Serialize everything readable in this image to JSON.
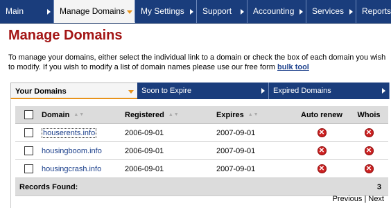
{
  "topnav": {
    "tabs": [
      {
        "label": "Main"
      },
      {
        "label": "Manage Domains",
        "active": true
      },
      {
        "label": "My Settings"
      },
      {
        "label": "Support"
      },
      {
        "label": "Accounting"
      },
      {
        "label": "Services"
      },
      {
        "label": "Reports"
      }
    ]
  },
  "page": {
    "title": "Manage Domains",
    "intro_text": "To manage your domains, either select the individual link to a domain or check the box of each domain you wish to modify. If you wish to modify a list of domain names please use our free form ",
    "intro_link": "bulk tool"
  },
  "subtabs": [
    {
      "label": "Your Domains",
      "active": true
    },
    {
      "label": "Soon to Expire"
    },
    {
      "label": "Expired Domains"
    }
  ],
  "table": {
    "headers": {
      "domain": "Domain",
      "registered": "Registered",
      "expires": "Expires",
      "auto_renew": "Auto renew",
      "whois": "Whois"
    },
    "rows": [
      {
        "domain": "houserents.info",
        "registered": "2006-09-01",
        "expires": "2007-09-01"
      },
      {
        "domain": "housingboom.info",
        "registered": "2006-09-01",
        "expires": "2007-09-01"
      },
      {
        "domain": "housingcrash.info",
        "registered": "2006-09-01",
        "expires": "2007-09-01"
      }
    ],
    "footer": {
      "label": "Records Found:",
      "count": "3"
    }
  },
  "pager": {
    "previous": "Previous",
    "separator": "|",
    "next": "Next"
  },
  "colors": {
    "nav_bg": "#1a3d7c",
    "title_red": "#a31515",
    "accent_orange": "#e8931c",
    "link_blue": "#1b3f8b"
  }
}
